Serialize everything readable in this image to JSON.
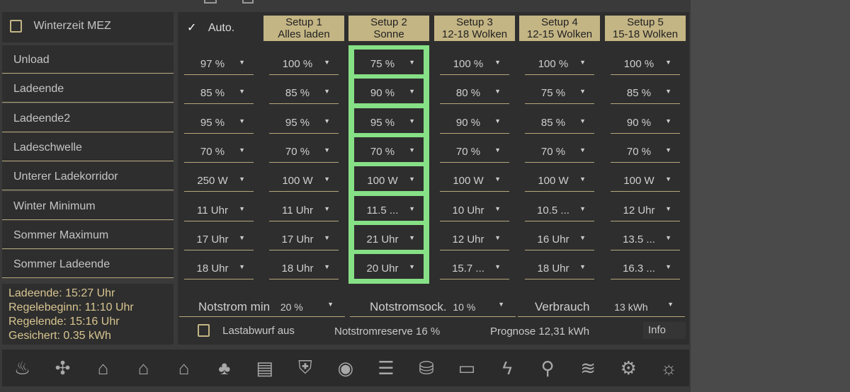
{
  "winterzeit": {
    "label": "Winterzeit MEZ",
    "checked": false
  },
  "auto": {
    "label": "Auto.",
    "checked": true
  },
  "setups": [
    {
      "line1": "Setup 1",
      "line2": "Alles laden"
    },
    {
      "line1": "Setup 2",
      "line2": "Sonne"
    },
    {
      "line1": "Setup 3",
      "line2": "12-18 Wolken"
    },
    {
      "line1": "Setup 4",
      "line2": "12-15 Wolken"
    },
    {
      "line1": "Setup 5",
      "line2": "15-18 Wolken"
    }
  ],
  "active_setup": 2,
  "accent": "#86e086",
  "rows": [
    {
      "label": "Unload",
      "values": [
        "97 %",
        "100 %",
        "75 %",
        "100 %",
        "100 %",
        "100 %"
      ]
    },
    {
      "label": "Ladeende",
      "values": [
        "85 %",
        "85 %",
        "90 %",
        "80 %",
        "75 %",
        "85 %"
      ]
    },
    {
      "label": "Ladeende2",
      "values": [
        "95 %",
        "95 %",
        "95 %",
        "90 %",
        "85 %",
        "90 %"
      ]
    },
    {
      "label": "Ladeschwelle",
      "values": [
        "70 %",
        "70 %",
        "70 %",
        "70 %",
        "70 %",
        "70 %"
      ]
    },
    {
      "label": "Unterer Ladekorridor",
      "values": [
        "250 W",
        "100 W",
        "100 W",
        "100 W",
        "100 W",
        "100 W"
      ]
    },
    {
      "label": "Winter Minimum",
      "values": [
        "11 Uhr",
        "11 Uhr",
        "11.5 ...",
        "10 Uhr",
        "10.5 ...",
        "12 Uhr"
      ]
    },
    {
      "label": "Sommer Maximum",
      "values": [
        "17 Uhr",
        "17 Uhr",
        "21 Uhr",
        "12 Uhr",
        "16 Uhr",
        "13.5 ..."
      ]
    },
    {
      "label": "Sommer Ladeende",
      "values": [
        "18 Uhr",
        "18 Uhr",
        "20 Uhr",
        "15.7 ...",
        "18 Uhr",
        "16.3 ..."
      ]
    }
  ],
  "status": [
    "Ladeende: 15:27 Uhr",
    "Regelebeginn: 11:10 Uhr",
    "Regelende: 15:16 Uhr",
    "Gesichert: 0.35 kWh"
  ],
  "bottom": {
    "notstrom_min": {
      "label": "Notstrom min",
      "value": "20 %"
    },
    "notstromsock": {
      "label": "Notstromsock.",
      "value": "10 %"
    },
    "verbrauch": {
      "label": "Verbrauch",
      "value": "13 kWh"
    },
    "lastabwurf": {
      "label": "Lastabwurf aus",
      "checked": false
    },
    "notstromreserve": "Notstromreserve  16 %",
    "prognose": "Prognose 12,31 kWh",
    "info": "Info"
  },
  "nav_icons": [
    {
      "name": "heating-icon",
      "glyph": "♨"
    },
    {
      "name": "ac-fan-icon",
      "glyph": "✣"
    },
    {
      "name": "house-floor-minus1-icon",
      "glyph": "⌂"
    },
    {
      "name": "house-floor-0-icon",
      "glyph": "⌂"
    },
    {
      "name": "house-floor-1-icon",
      "glyph": "⌂"
    },
    {
      "name": "tree-icon",
      "glyph": "♣"
    },
    {
      "name": "shutter-icon",
      "glyph": "▤"
    },
    {
      "name": "security-shield-icon",
      "glyph": "⛨"
    },
    {
      "name": "camera-icon",
      "glyph": "◉"
    },
    {
      "name": "list-icon",
      "glyph": "☰"
    },
    {
      "name": "database-sync-icon",
      "glyph": "⛁"
    },
    {
      "name": "clock-display-icon",
      "glyph": "▭"
    },
    {
      "name": "power-icon",
      "glyph": "ϟ"
    },
    {
      "name": "water-tap-icon",
      "glyph": "⚲"
    },
    {
      "name": "pool-icon",
      "glyph": "≋"
    },
    {
      "name": "settings-gear-icon",
      "glyph": "⚙"
    },
    {
      "name": "weather-icon",
      "glyph": "☼"
    }
  ]
}
